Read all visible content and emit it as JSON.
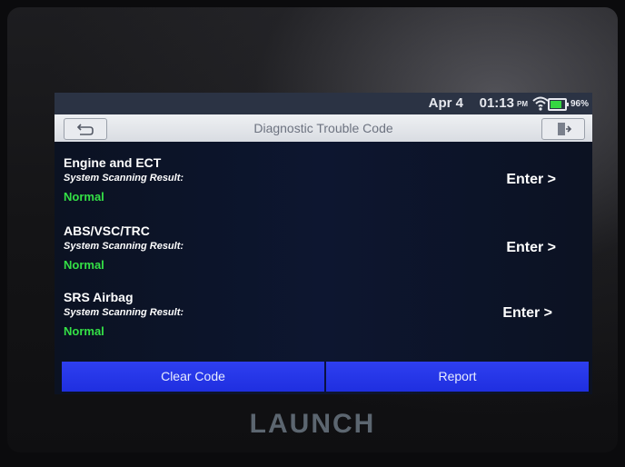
{
  "brand": "LAUNCH",
  "status_bar": {
    "date": "Apr 4",
    "time": "01:13",
    "ampm": "PM",
    "battery": "96%",
    "wifi_icon": "wifi-icon",
    "battery_icon": "battery-icon"
  },
  "header": {
    "title": "Diagnostic Trouble Code",
    "back_icon": "back-arrow-icon",
    "exit_icon": "exit-door-icon"
  },
  "systems": [
    {
      "name": "Engine and ECT",
      "label": "System Scanning Result:",
      "result": "Normal",
      "action": "Enter >"
    },
    {
      "name": "ABS/VSC/TRC",
      "label": "System Scanning Result:",
      "result": "Normal",
      "action": "Enter >"
    },
    {
      "name": "SRS Airbag",
      "label": "System Scanning Result:",
      "result": "Normal",
      "action": "Enter >"
    }
  ],
  "footer": {
    "clear_code": "Clear Code",
    "report": "Report"
  },
  "colors": {
    "normal_green": "#34e046",
    "button_blue": "#2a3bee",
    "title_bar": "#e2e5ea"
  }
}
